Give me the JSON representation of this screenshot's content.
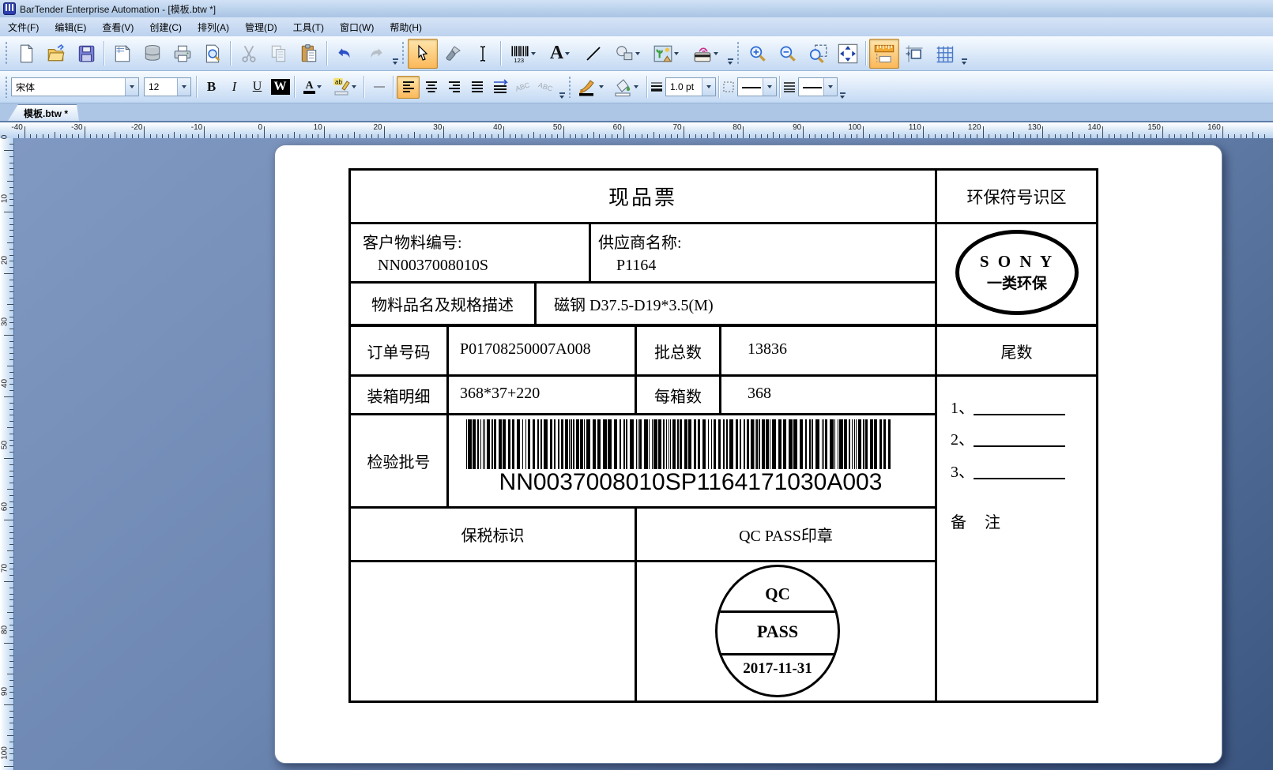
{
  "window": {
    "title": "BarTender Enterprise Automation - [模板.btw *]"
  },
  "menu": {
    "items": [
      "文件(F)",
      "编辑(E)",
      "查看(V)",
      "创建(C)",
      "排列(A)",
      "管理(D)",
      "工具(T)",
      "窗口(W)",
      "帮助(H)"
    ]
  },
  "format_toolbar": {
    "font_name": "宋体",
    "font_size": "12",
    "line_weight": "1.0 pt"
  },
  "glyphs": {
    "bold": "B",
    "italic": "I",
    "underline": "U",
    "wrap": "W",
    "font_color": "A",
    "highlight": "ab",
    "text_tool": "A",
    "barcode_digits": "123",
    "abc": "ABC"
  },
  "tabs": {
    "active": "模板.btw *"
  },
  "rulers": {
    "horizontal": [
      -40,
      -30,
      -20,
      -10,
      0,
      10,
      20,
      30,
      40,
      50,
      60,
      70,
      80,
      90,
      100,
      110,
      120,
      130,
      140,
      150,
      160
    ],
    "vertical": [
      0,
      10,
      20,
      30,
      40,
      50,
      60,
      70,
      80,
      90,
      100
    ]
  },
  "label": {
    "title": "现品票",
    "eco_zone_header": "环保符号识区",
    "eco_mark": {
      "line1": "S O N Y",
      "line2": "一类环保"
    },
    "customer_part": {
      "label": "客户物料编号:",
      "value": "NN0037008010S"
    },
    "supplier": {
      "label": "供应商名称:",
      "value": "P1164"
    },
    "description": {
      "label": "物料品名及规格描述",
      "value": "磁钢 D37.5-D19*3.5(M)"
    },
    "order": {
      "label": "订单号码",
      "value": "P01708250007A008"
    },
    "batch_total": {
      "label": "批总数",
      "value": "13836"
    },
    "packing": {
      "label": "装箱明细",
      "value": "368*37+220"
    },
    "per_box": {
      "label": "每箱数",
      "value": "368"
    },
    "inspection": {
      "label": "检验批号",
      "barcode_text": "NN0037008010SP1164171030A003"
    },
    "tail": {
      "label": "尾数",
      "list": [
        "1、",
        "2、",
        "3、"
      ],
      "remark": "备 注"
    },
    "bonded": {
      "label": "保税标识"
    },
    "qc": {
      "label": "QC PASS印章",
      "stamp": [
        "QC",
        "PASS",
        "2017-11-31"
      ]
    }
  }
}
